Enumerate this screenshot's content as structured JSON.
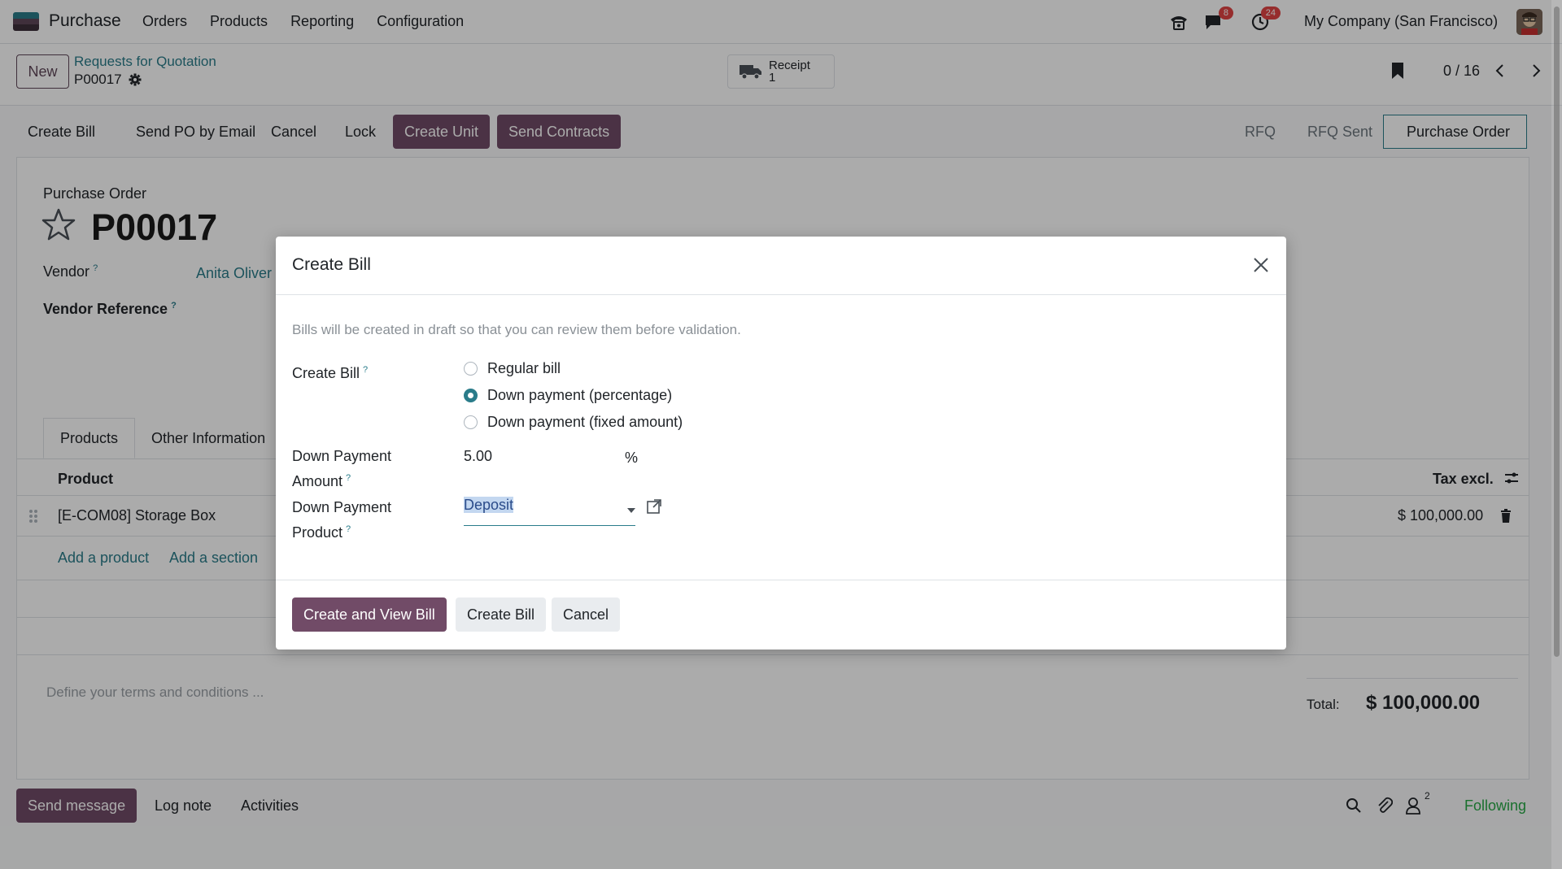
{
  "navbar": {
    "app_name": "Purchase",
    "menu": [
      "Orders",
      "Products",
      "Reporting",
      "Configuration"
    ],
    "messages_count": "8",
    "activities_count": "24",
    "company": "My Company (San Francisco)"
  },
  "control": {
    "new_label": "New",
    "breadcrumb_parent": "Requests for Quotation",
    "breadcrumb_current": "P00017",
    "receipt_label": "Receipt",
    "receipt_count": "1",
    "pager": "0 / 16"
  },
  "statusbar": {
    "actions": [
      "Create Bill",
      "Send PO by Email",
      "Cancel",
      "Lock"
    ],
    "primary_actions": [
      "Create Unit",
      "Send Contracts"
    ],
    "stages": [
      "RFQ",
      "RFQ Sent",
      "Purchase Order"
    ]
  },
  "form": {
    "doc_type": "Purchase Order",
    "title": "P00017",
    "vendor_label": "Vendor",
    "vendor_value": "Anita Oliver",
    "vendor_ref_label": "Vendor Reference",
    "tabs": [
      "Products",
      "Other Information"
    ],
    "col_product": "Product",
    "col_tax": "Tax excl.",
    "line_product": "[E-COM08] Storage Box",
    "line_amount": "$ 100,000.00",
    "add_product": "Add a product",
    "add_section": "Add a section",
    "terms_placeholder": "Define your terms and conditions ...",
    "total_label": "Total:",
    "total_value": "$ 100,000.00"
  },
  "chatter": {
    "send_message": "Send message",
    "log_note": "Log note",
    "activities": "Activities",
    "followers_count": "2",
    "following": "Following"
  },
  "modal": {
    "title": "Create Bill",
    "hint": "Bills will be created in draft so that you can review them before validation.",
    "create_bill_label": "Create Bill",
    "options": [
      "Regular bill",
      "Down payment (percentage)",
      "Down payment (fixed amount)"
    ],
    "selected_option": 1,
    "amount_label_1": "Down Payment",
    "amount_label_2": "Amount",
    "amount_value": "5.00",
    "amount_unit": "%",
    "product_label_1": "Down Payment",
    "product_label_2": "Product",
    "product_value": "Deposit",
    "btn_create_view": "Create and View Bill",
    "btn_create": "Create Bill",
    "btn_cancel": "Cancel"
  },
  "colors": {
    "brand": "#714b67",
    "link": "#2a7c8a",
    "badge": "#e04444"
  }
}
